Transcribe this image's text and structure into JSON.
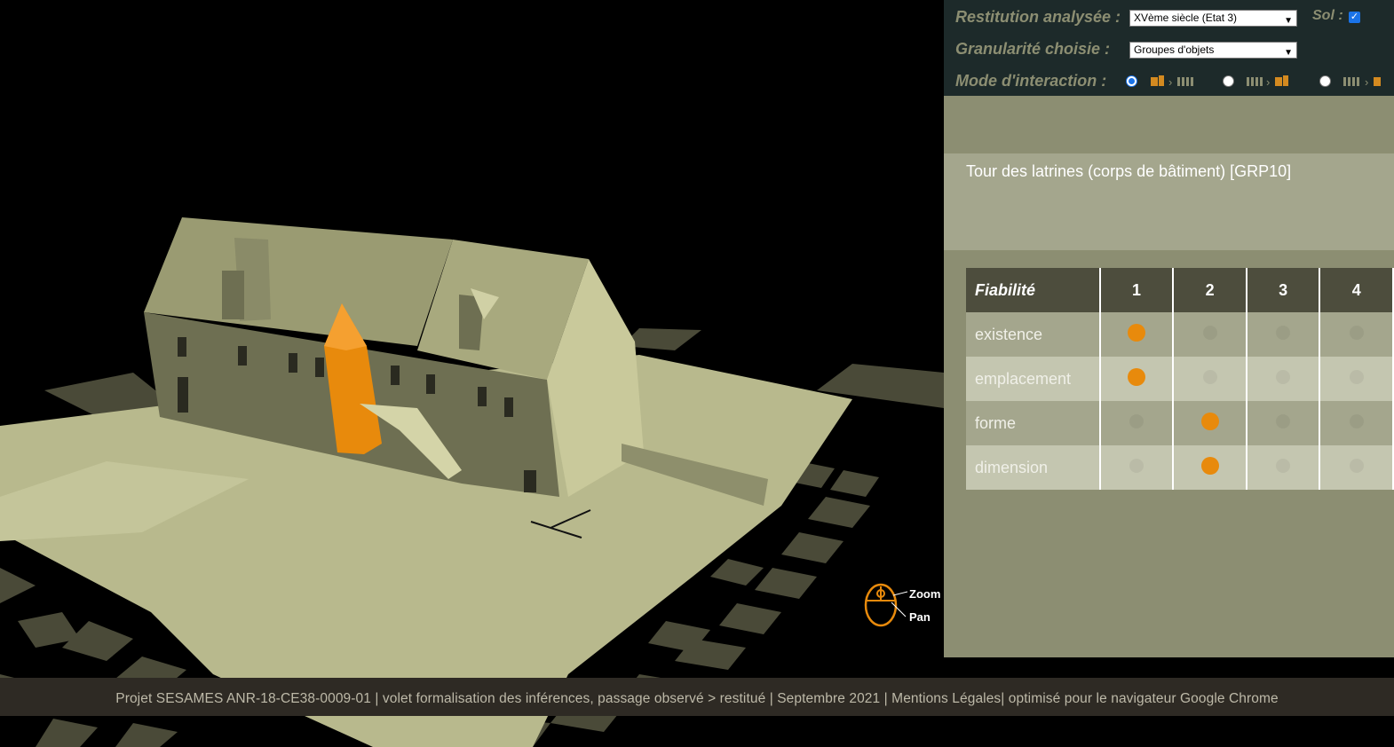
{
  "controls": {
    "restitution_label": "Restitution analysée :",
    "restitution_value": "XVème siècle (Etat 3)",
    "sol_label": "Sol :",
    "sol_checked": true,
    "granularite_label": "Granularité choisie :",
    "granularite_value": "Groupes d'objets",
    "mode_label": "Mode d'interaction :",
    "mode_selected": 0
  },
  "panel": {
    "object_title": "Tour des latrines (corps de bâtiment) [GRP10]",
    "table": {
      "header": "Fiabilité",
      "columns": [
        "1",
        "2",
        "3",
        "4"
      ],
      "rows": [
        {
          "label": "existence",
          "level": 1
        },
        {
          "label": "emplacement",
          "level": 1
        },
        {
          "label": "forme",
          "level": 2
        },
        {
          "label": "dimension",
          "level": 2
        }
      ]
    }
  },
  "hint": {
    "zoom": "Zoom",
    "pan": "Pan"
  },
  "footer": "Projet SESAMES ANR-18-CE38-0009-01 | volet formalisation des inférences, passage observé > restitué | Septembre 2021 | Mentions Légales| optimisé pour le navigateur Google Chrome",
  "colors": {
    "accent": "#e88a0c",
    "panel": "#8c8e72",
    "footer": "#2e2a24"
  }
}
